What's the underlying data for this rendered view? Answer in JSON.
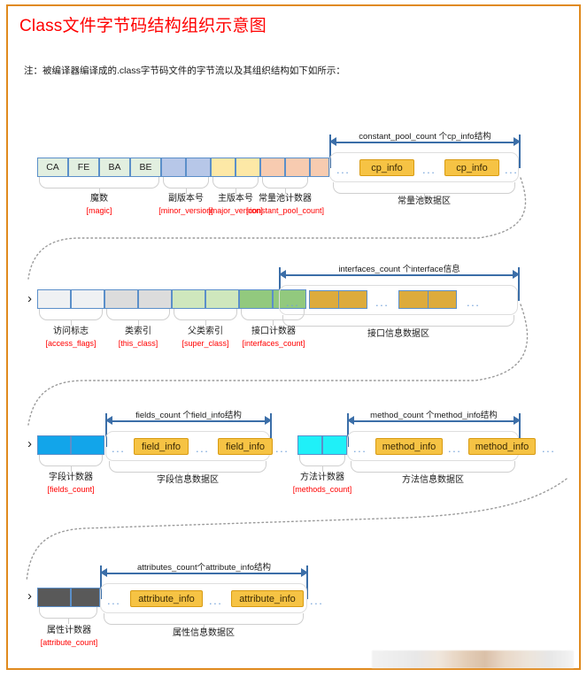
{
  "document": {
    "title": "Class文件字节码结构组织示意图",
    "note": "注：被编译器编译成的.class字节码文件的字节流以及其组织结构如下如所示：",
    "accent_color": "#ff0000",
    "frame_color": "#e08a1e"
  },
  "rows": [
    {
      "id": "row-magic-constantpool",
      "bytes": [
        "CA",
        "FE",
        "BA",
        "BE"
      ],
      "fields": [
        {
          "name": "魔数",
          "code": "magic",
          "cells": 4,
          "color": "#e2efe0"
        },
        {
          "name": "副版本号",
          "code": "minor_version",
          "cells": 2,
          "color": "#b7c7e8"
        },
        {
          "name": "主版本号",
          "code": "major_version",
          "cells": 2,
          "color": "#fde8a6"
        },
        {
          "name": "常量池计数器",
          "code": "constant_pool_count",
          "cells": 2,
          "color": "#f7cbb0"
        }
      ],
      "measure_label": "constant_pool_count 个cp_info结构",
      "group_label": "常量池数据区",
      "repeat_item": "cp_info"
    },
    {
      "id": "row-accessflags-interfaces",
      "bytes": [],
      "fields": [
        {
          "name": "访问标志",
          "code": "access_flags",
          "cells": 2,
          "color": "#eff1f3"
        },
        {
          "name": "类索引",
          "code": "this_class",
          "cells": 2,
          "color": "#dcdcdc"
        },
        {
          "name": "父类索引",
          "code": "super_class",
          "cells": 2,
          "color": "#cfe7bd"
        },
        {
          "name": "接口计数器",
          "code": "interfaces_count",
          "cells": 2,
          "color": "#92c97e"
        }
      ],
      "measure_label": "interfaces_count 个interface信息",
      "group_label": "接口信息数据区",
      "repeat_item": ""
    },
    {
      "id": "row-fields",
      "bytes": [],
      "fields": [
        {
          "name": "字段计数器",
          "code": "fields_count",
          "cells": 2,
          "color": "#12a5ea"
        }
      ],
      "measure_label": "fields_count 个field_info结构",
      "group_label": "字段信息数据区",
      "repeat_item": "field_info"
    },
    {
      "id": "row-methods",
      "bytes": [],
      "fields": [
        {
          "name": "方法计数器",
          "code": "methods_count",
          "cells": 2,
          "color": "#1ff0f8"
        }
      ],
      "measure_label": "method_count 个method_info结构",
      "group_label": "方法信息数据区",
      "repeat_item": "method_info"
    },
    {
      "id": "row-attributes",
      "bytes": [],
      "fields": [
        {
          "name": "属性计数器",
          "code": "attribute_count",
          "cells": 2,
          "color": "#595959"
        }
      ],
      "measure_label": "attributes_count个attribute_info结构",
      "group_label": "属性信息数据区",
      "repeat_item": "attribute_info"
    }
  ],
  "symbols": {
    "ellipsis": "...",
    "flow_arrow": "›"
  }
}
